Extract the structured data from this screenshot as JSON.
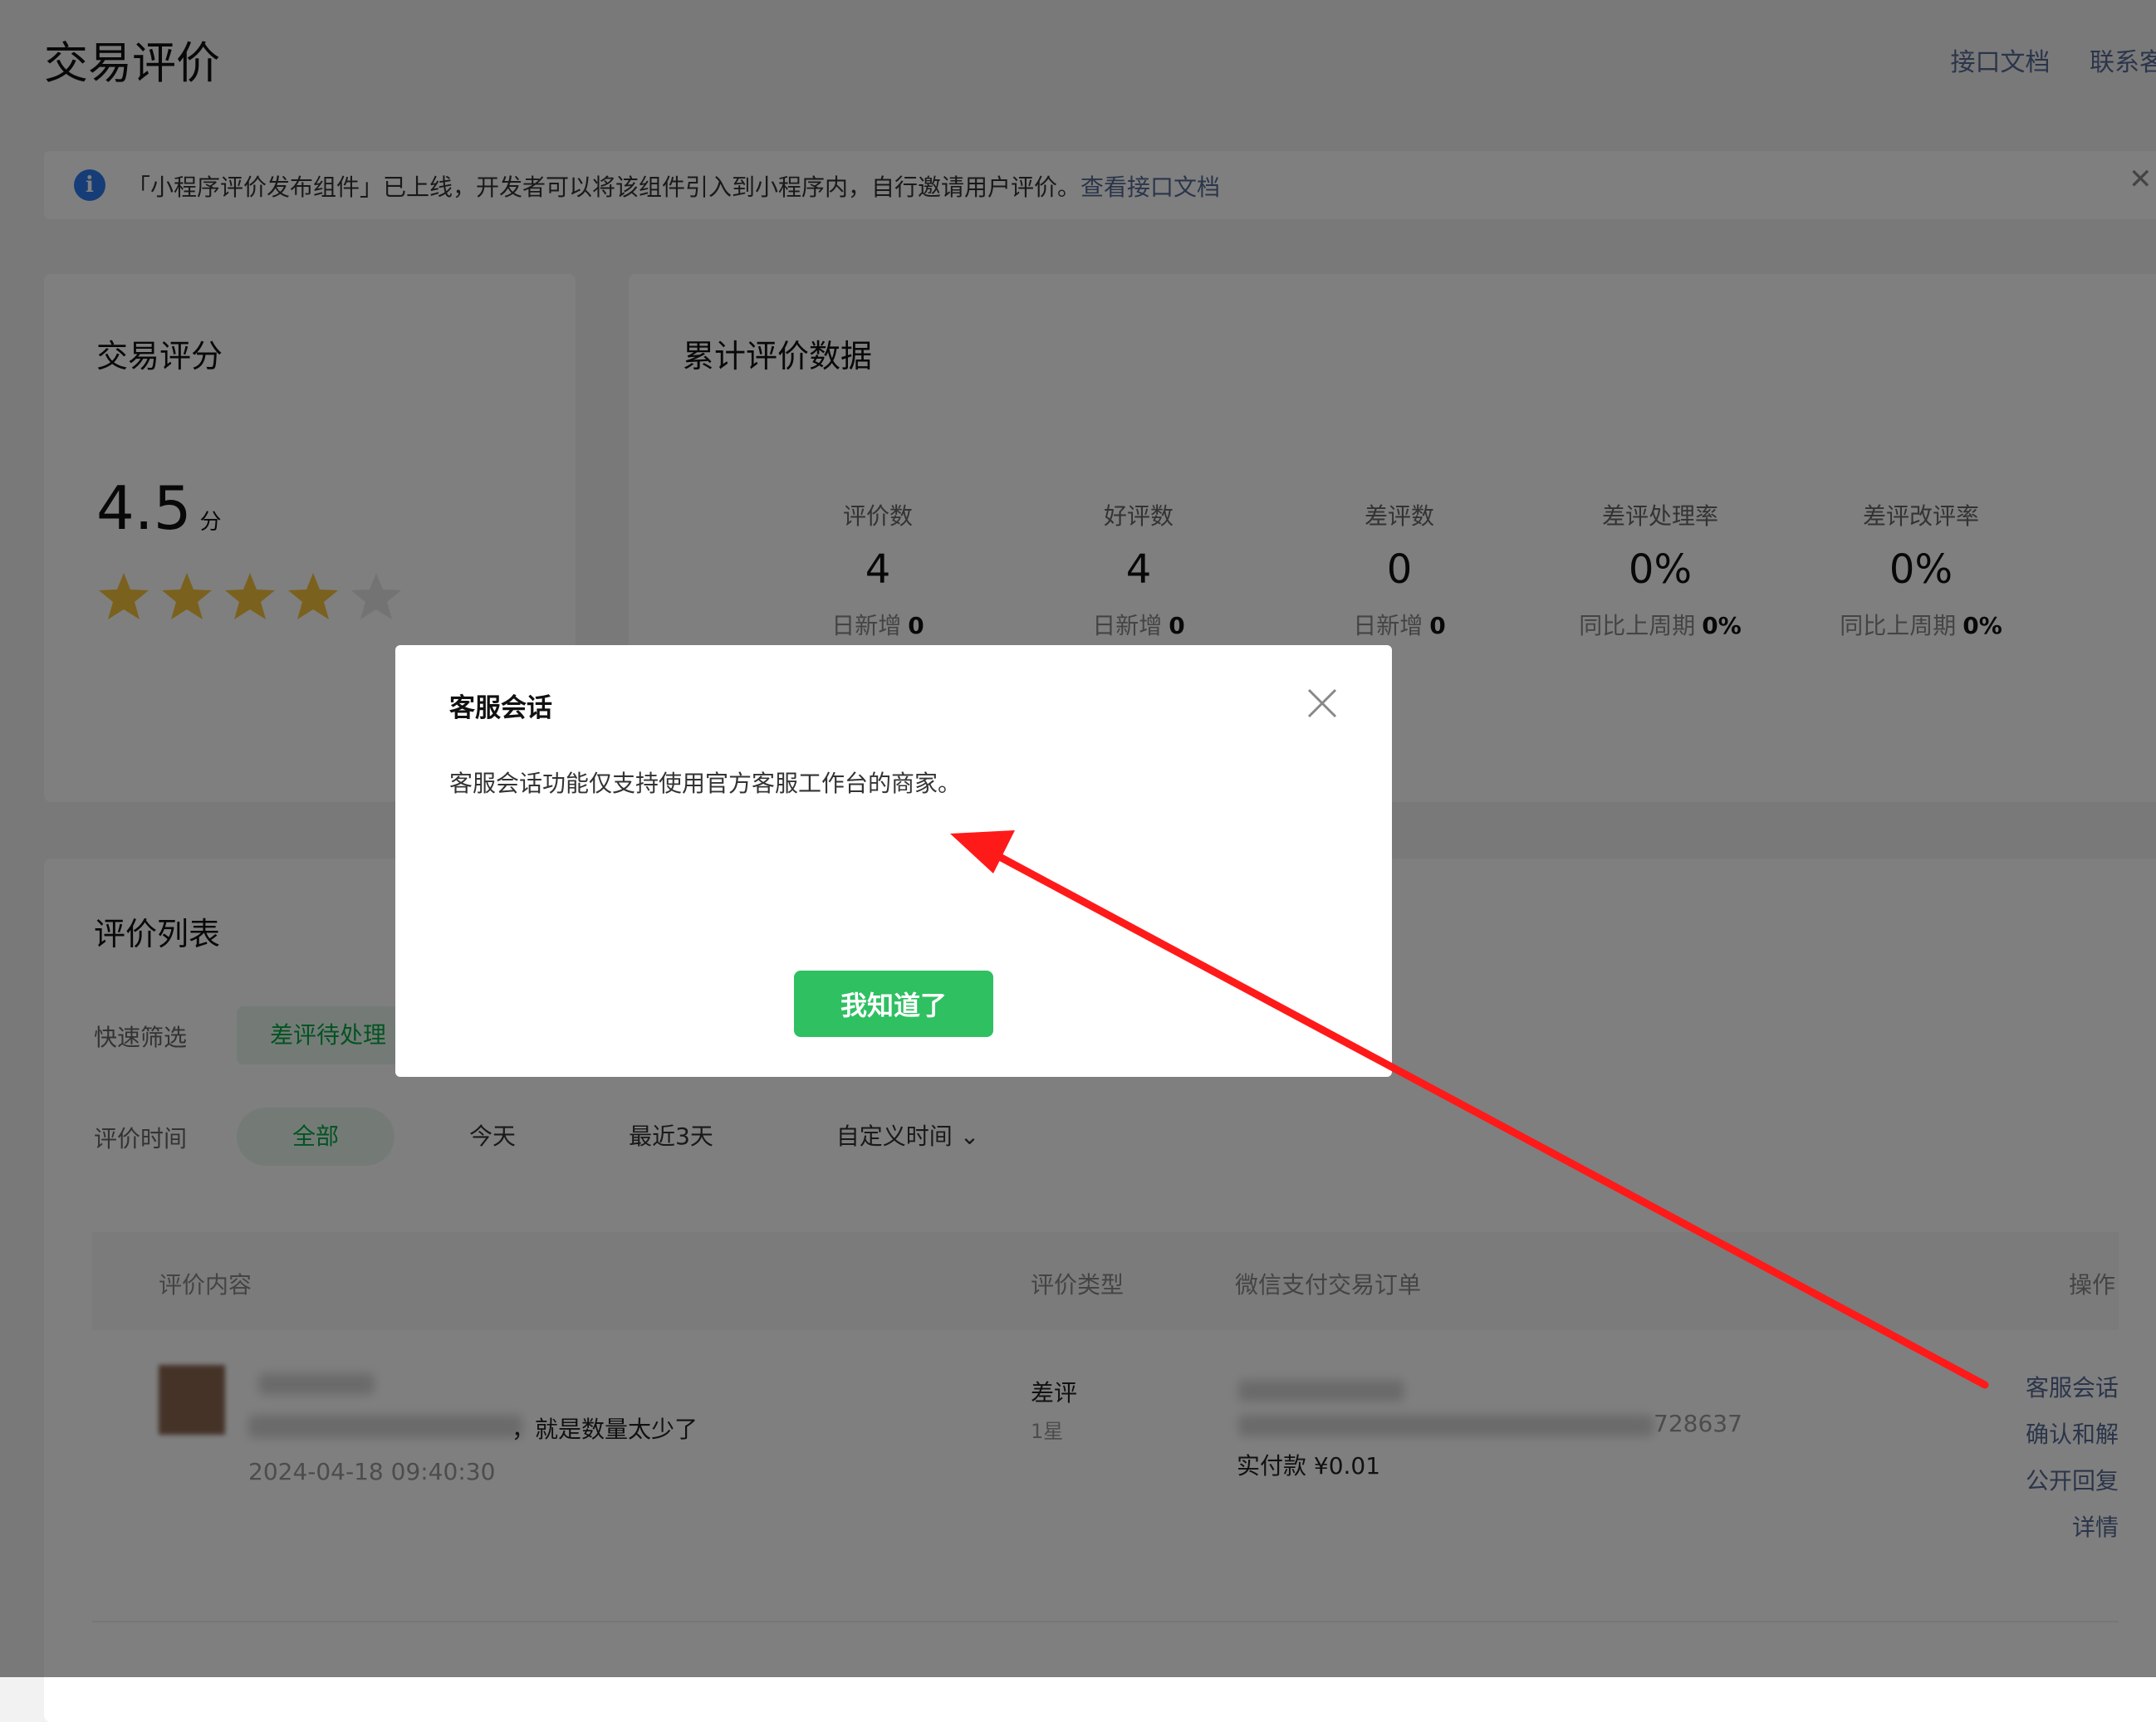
{
  "page": {
    "title": "交易评价",
    "links": [
      "接口文档",
      "联系客服"
    ]
  },
  "notice": {
    "text": "「小程序评价发布组件」已上线，开发者可以将该组件引入到小程序内，自行邀请用户评价。",
    "link": "查看接口文档"
  },
  "score_card": {
    "title": "交易评分",
    "value": "4.5",
    "unit": "分",
    "stars": 4,
    "stars_total": 5
  },
  "stats_card": {
    "title": "累计评价数据",
    "items": [
      {
        "label": "评价数",
        "value": "4",
        "sub_label": "日新增",
        "sub_value": "0"
      },
      {
        "label": "好评数",
        "value": "4",
        "sub_label": "日新增",
        "sub_value": "0"
      },
      {
        "label": "差评数",
        "value": "0",
        "sub_label": "日新增",
        "sub_value": "0"
      },
      {
        "label": "差评处理率",
        "value": "0%",
        "sub_label": "同比上周期",
        "sub_value": "0%"
      },
      {
        "label": "差评改评率",
        "value": "0%",
        "sub_label": "同比上周期",
        "sub_value": "0%"
      }
    ]
  },
  "list_card": {
    "title": "评价列表",
    "quick_filter_label": "快速筛选",
    "quick_filter_chip": "差评待处理",
    "time_filter_label": "评价时间",
    "time_options": [
      "全部",
      "今天",
      "最近3天",
      "自定义时间"
    ],
    "columns": [
      "评价内容",
      "评价类型",
      "微信支付交易订单",
      "操作"
    ],
    "row": {
      "content_visible": "，就是数量太少了",
      "date": "2024-04-18 09:40:30",
      "type": "差评",
      "stars": "1星",
      "order_suffix": "728637",
      "payment": "实付款 ¥0.01",
      "ops": [
        "客服会话",
        "确认和解",
        "公开回复",
        "详情"
      ]
    }
  },
  "modal": {
    "title": "客服会话",
    "body": "客服会话功能仅支持使用官方客服工作台的商家。",
    "button": "我知道了"
  },
  "colors": {
    "accent_green": "#2fc062",
    "link_blue": "#576b95",
    "star_gold": "#f5c33b",
    "annotation_red": "#ff1a1a"
  }
}
